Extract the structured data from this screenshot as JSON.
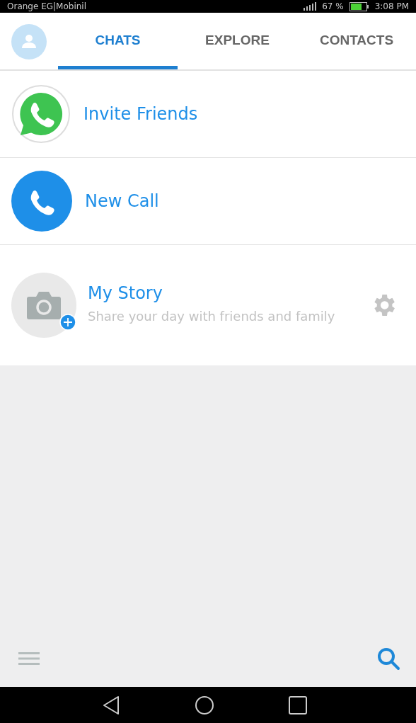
{
  "status_bar": {
    "carrier": "Orange EG|Mobinil",
    "battery_percent": "67 %",
    "time": "3:08 PM"
  },
  "tabs": [
    {
      "label": "CHATS",
      "selected": true
    },
    {
      "label": "EXPLORE",
      "selected": false
    },
    {
      "label": "CONTACTS",
      "selected": false
    }
  ],
  "items": [
    {
      "kind": "invite",
      "title": "Invite Friends"
    },
    {
      "kind": "call",
      "title": "New Call"
    },
    {
      "kind": "story",
      "title": "My Story",
      "subtitle": "Share your day with friends and family"
    }
  ]
}
